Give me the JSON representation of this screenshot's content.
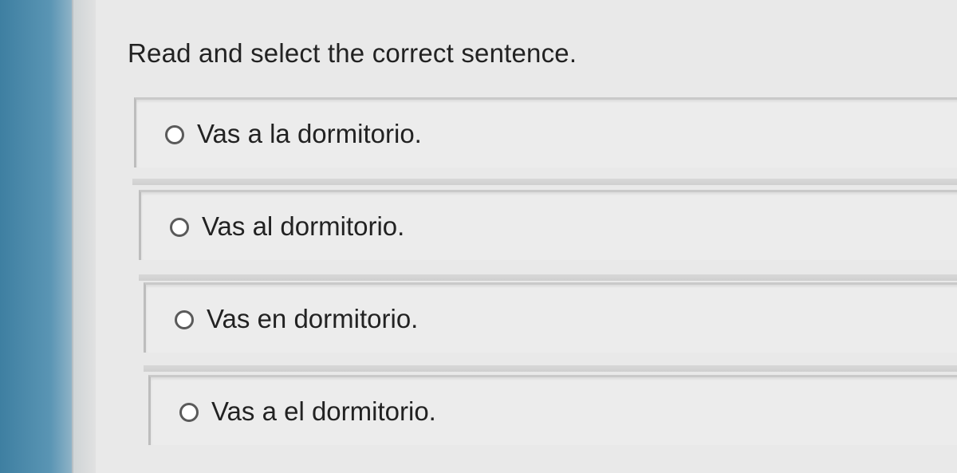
{
  "question": {
    "text": "Read and select the correct sentence."
  },
  "options": [
    {
      "label": "Vas a la dormitorio.",
      "selected": false
    },
    {
      "label": "Vas al dormitorio.",
      "selected": false
    },
    {
      "label": "Vas en dormitorio.",
      "selected": false
    },
    {
      "label": "Vas a el dormitorio.",
      "selected": false
    }
  ],
  "colors": {
    "sidebar": "#3e7fa1",
    "background": "#e9e9e9",
    "text": "#222222",
    "radio_border": "#5a5a5a"
  }
}
